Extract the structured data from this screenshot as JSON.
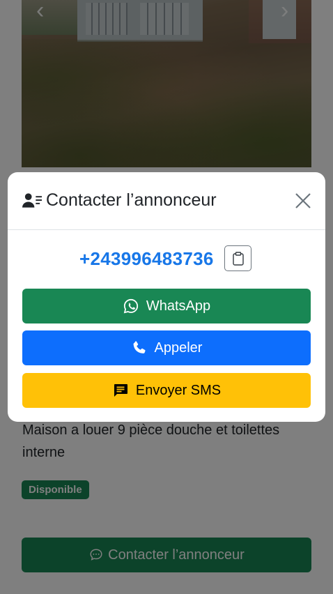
{
  "listing": {
    "description": "Maison a louer 9 pièce douche et toilettes interne",
    "status_badge": "Disponible",
    "contact_button_label": "Contacter l’annonceur"
  },
  "gallery": {
    "prev_icon": "chevron-left-icon",
    "next_icon": "chevron-right-icon"
  },
  "modal": {
    "title": "Contacter l’annonceur",
    "title_icon": "user-list-icon",
    "close_icon": "close-icon",
    "phone_number": "+243996483736",
    "copy_icon": "clipboard-icon",
    "buttons": {
      "whatsapp": "WhatsApp",
      "call": "Appeler",
      "sms": "Envoyer SMS"
    }
  },
  "colors": {
    "success": "#198754",
    "primary": "#0d6efd",
    "warning": "#ffc107",
    "phone_link": "#1877e8"
  }
}
